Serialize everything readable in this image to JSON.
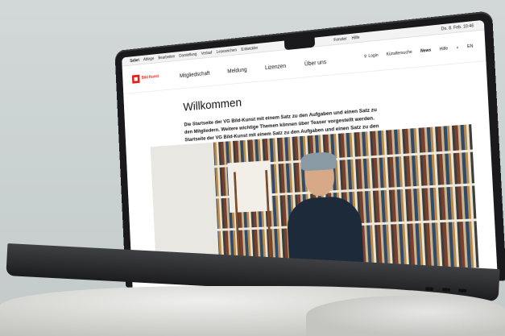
{
  "menubar": {
    "app": "Safari",
    "items": [
      "Ablage",
      "Bearbeiten",
      "Darstellung",
      "Verlauf",
      "Lesezeichen",
      "Entwickler",
      "Fenster",
      "Hilfe"
    ],
    "datetime": "Do. 8. Feb. 10:46"
  },
  "site": {
    "logo": "Bild Kunst",
    "nav": [
      "Mitgliedschaft",
      "Meldung",
      "Lizenzen",
      "Über uns"
    ],
    "right_nav": [
      "Login",
      "Künstlersuche",
      "News",
      "Hilfe",
      "EN"
    ],
    "search_icon": "search-icon",
    "login_icon": "user-icon"
  },
  "content": {
    "title": "Willkommen",
    "intro": "Die Startseite der VG Bild-Kunst mit einem Satz zu den Aufgaben und einen Satz zu den Mitgliedern. Weitere wichtige Themen können über Teaser vorgestellt werden. Startseite der VG Bild-Kunst mit einem Satz zu den Aufgaben und einen Satz zu den Mitgliedern."
  },
  "colors": {
    "brand": "#e2231a"
  }
}
